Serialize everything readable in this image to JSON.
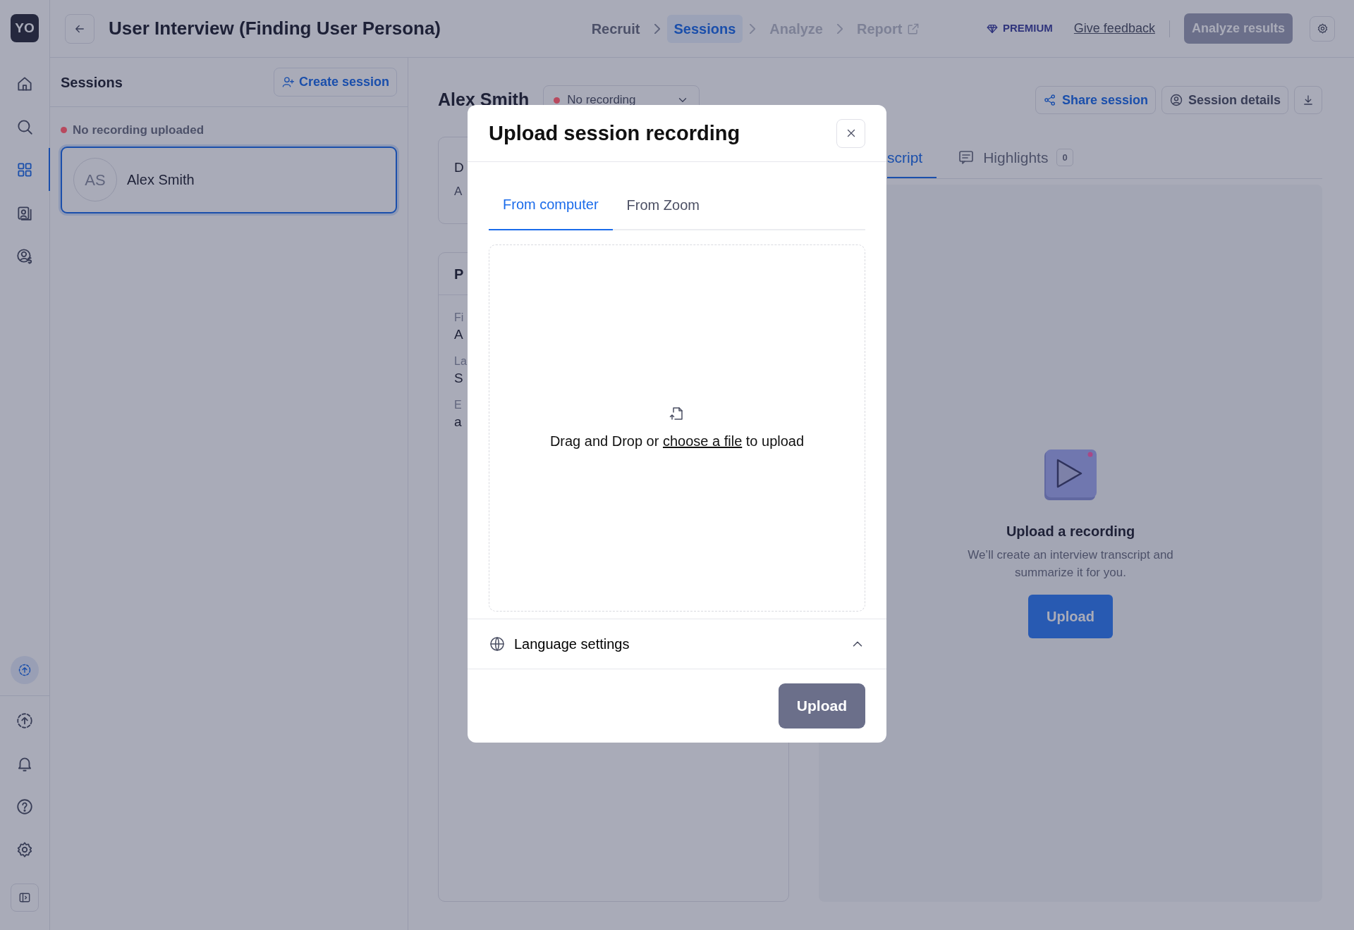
{
  "rail": {
    "avatar": "YO",
    "top_items": [
      {
        "selected": false
      },
      {
        "selected": false
      },
      {
        "selected": true
      },
      {
        "selected": false
      },
      {
        "selected": false
      }
    ],
    "bottom_items": [
      {
        "selected": true
      },
      {
        "selected": false
      },
      {
        "selected": false
      },
      {
        "selected": false
      },
      {
        "selected": false
      }
    ]
  },
  "header": {
    "title": "User Interview (Finding User Persona)",
    "steps": [
      {
        "label": "Recruit",
        "selected": false,
        "disabled": false,
        "external": false
      },
      {
        "label": "Sessions",
        "selected": true,
        "disabled": false,
        "external": false
      },
      {
        "label": "Analyze",
        "selected": false,
        "disabled": true,
        "external": false
      },
      {
        "label": "Report",
        "selected": false,
        "disabled": true,
        "external": true
      }
    ],
    "premium": "PREMIUM",
    "feedback": "Give feedback",
    "analyze_button": "Analyze results"
  },
  "sessions_panel": {
    "title": "Sessions",
    "create_button": "Create session",
    "group": {
      "label": "No recording uploaded",
      "color": "#b8495e"
    },
    "sessions": [
      {
        "initials": "AS",
        "name": "Alex Smith",
        "selected": true
      }
    ]
  },
  "session": {
    "name": "Alex Smith",
    "recording": {
      "label": "No recording",
      "color": "#b8495e"
    },
    "actions": [
      "Share session",
      "Session details"
    ],
    "summary_card": {
      "lines": [
        "D",
        "A"
      ]
    },
    "profile_card": {
      "heading": "P",
      "fields": [
        {
          "label": "Fi",
          "value": "A"
        },
        {
          "label": "La",
          "value": "S"
        },
        {
          "label": "E",
          "value": "a"
        }
      ]
    },
    "tabs": [
      {
        "label": "script",
        "selected": true
      },
      {
        "label": "Highlights",
        "selected": false,
        "count": "0"
      }
    ],
    "empty_state": {
      "title": "Upload a recording",
      "description": "We’ll create an interview transcript and summarize it for you.",
      "button": "Upload"
    }
  },
  "modal": {
    "title": "Upload session recording",
    "tabs": [
      {
        "label": "From computer",
        "selected": true
      },
      {
        "label": "From Zoom",
        "selected": false
      }
    ],
    "dropzone": {
      "text_before": "Drag and Drop or ",
      "link": "choose a file",
      "text_after": " to upload"
    },
    "language": {
      "label": "Language settings"
    },
    "upload_button": {
      "label": "Upload",
      "disabled": true
    }
  }
}
